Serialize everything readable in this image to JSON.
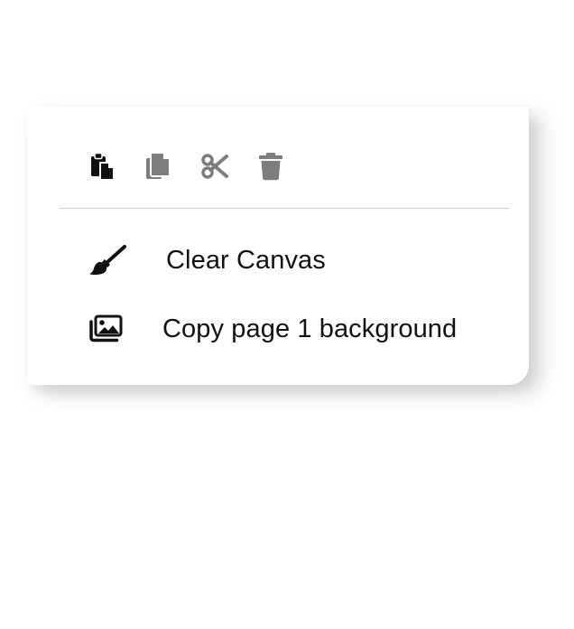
{
  "context_menu": {
    "toolbar": [
      {
        "icon": "paste-icon",
        "label": "Paste",
        "color": "#111111"
      },
      {
        "icon": "copy-icon",
        "label": "Copy",
        "color": "#7d7d7d"
      },
      {
        "icon": "scissors-icon",
        "label": "Cut",
        "color": "#7d7d7d"
      },
      {
        "icon": "trash-icon",
        "label": "Delete",
        "color": "#7d7d7d"
      }
    ],
    "items": [
      {
        "icon": "paint-brush-icon",
        "label": "Clear Canvas"
      },
      {
        "icon": "images-icon",
        "label": "Copy page 1 background"
      }
    ]
  },
  "colors": {
    "enabled_icon": "#111111",
    "disabled_icon": "#7d7d7d",
    "text": "#111111",
    "divider": "#cfcfcf"
  }
}
